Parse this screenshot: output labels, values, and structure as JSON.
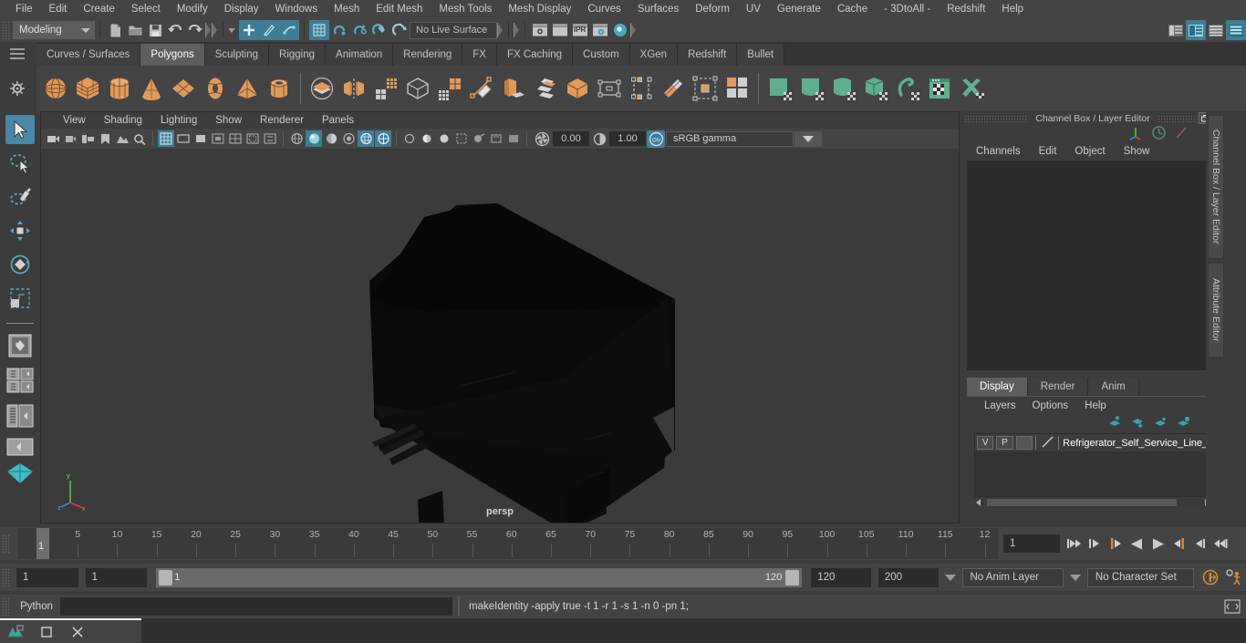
{
  "menubar": {
    "items": [
      "File",
      "Edit",
      "Create",
      "Select",
      "Modify",
      "Display",
      "Windows",
      "Mesh",
      "Edit Mesh",
      "Mesh Tools",
      "Mesh Display",
      "Curves",
      "Surfaces",
      "Deform",
      "UV",
      "Generate",
      "Cache",
      "- 3DtoAll -",
      "Redshift",
      "Help"
    ]
  },
  "statusline": {
    "menu_set": "Modeling",
    "live_surface": "No Live Surface",
    "ipr_label": "IPR",
    "icons": [
      "new-scene-icon",
      "open-scene-icon",
      "save-scene-icon",
      "undo-icon",
      "redo-icon",
      "select-by-hierarchy-icon",
      "select-by-object-icon",
      "select-by-component-icon",
      "snap-to-grid-icon",
      "snap-to-curve-icon",
      "snap-to-point-icon",
      "snap-to-projected-center-icon",
      "snap-to-view-plane-icon",
      "magnet-icon",
      "make-live-icon",
      "render-current-frame-icon",
      "ipr-render-icon",
      "render-settings-icon",
      "hypershade-icon",
      "show-channel-box-icon",
      "show-attribute-editor-icon",
      "show-tool-settings-icon"
    ]
  },
  "shelf": {
    "tabs": [
      "Curves / Surfaces",
      "Polygons",
      "Sculpting",
      "Rigging",
      "Animation",
      "Rendering",
      "FX",
      "FX Caching",
      "Custom",
      "XGen",
      "Redshift",
      "Bullet"
    ],
    "active_tab": "Polygons",
    "icons": [
      "poly-sphere-icon",
      "poly-cube-icon",
      "poly-cylinder-icon",
      "poly-cone-icon",
      "poly-plane-icon",
      "poly-torus-icon",
      "poly-pyramid-icon",
      "poly-pipe-icon",
      "poly-sphere-boolean-icon",
      "poly-combine-icon",
      "poly-mirror-icon",
      "poly-smooth-icon",
      "poly-extrude-icon",
      "poly-subdiv-icon",
      "poly-create-tool-icon",
      "poly-bevel-icon",
      "poly-bridge-icon",
      "poly-cube-duplicate-icon",
      "poly-quad-draw-icon",
      "poly-target-weld-icon",
      "poly-multi-cut-icon",
      "poly-separate-icon",
      "poly-merge-icon",
      "sculpt-grab-icon",
      "sculpt-smooth-icon",
      "sculpt-relax-icon",
      "sculpt-cube-icon",
      "sculpt-flow-icon",
      "sculpt-mask-icon",
      "sculpt-mirror-icon"
    ]
  },
  "toolbox": {
    "items": [
      "select-tool-icon",
      "lasso-select-tool-icon",
      "paint-select-tool-icon",
      "move-tool-icon",
      "rotate-tool-icon",
      "scale-tool-icon",
      "last-tool-icon",
      "four-view-layout-icon",
      "persp-outliner-layout-icon",
      "outliner-persp-layout-icon",
      "persp-graph-layout-icon",
      "hypershade-persp-layout-icon"
    ],
    "selected": "select-tool-icon"
  },
  "viewport": {
    "menu": [
      "View",
      "Shading",
      "Lighting",
      "Show",
      "Renderer",
      "Panels"
    ],
    "exposure_value": "0.00",
    "gamma_value": "1.00",
    "color_management": "sRGB gamma",
    "view_label": "persp",
    "axis_labels": [
      "x",
      "y",
      "z"
    ],
    "toolbar_icons": [
      "select-camera-icon",
      "lock-camera-icon",
      "camera-attributes-icon",
      "bookmarks-icon",
      "image-plane-icon",
      "two-d-pan-zoom-icon",
      "grid-icon",
      "film-gate-icon",
      "resolution-gate-icon",
      "gate-mask-icon",
      "field-chart-icon",
      "safe-action-icon",
      "safe-title-icon",
      "wireframe-icon",
      "smooth-shade-all-icon",
      "smooth-shade-selected-icon",
      "flat-shade-all-icon",
      "shaded-and-textured-icon",
      "use-default-material-icon",
      "wireframe-on-shaded-icon",
      "xray-icon",
      "xray-joints-icon",
      "xray-active-components-icon",
      "lighting-none-icon",
      "lighting-default-icon",
      "lighting-all-icon",
      "shadows-icon",
      "screen-space-ao-icon",
      "motion-blur-icon",
      "multisample-icon",
      "exposure-icon",
      "gamma-icon",
      "color-management-toggle-icon"
    ]
  },
  "channel_box": {
    "panel_title": "Channel Box / Layer Editor",
    "menu": [
      "Channels",
      "Edit",
      "Object",
      "Show"
    ],
    "header_icons": [
      "axis-orient-icon",
      "clock-icon",
      "pen-icon"
    ],
    "window_buttons": [
      "restore-window-icon",
      "close-window-icon"
    ],
    "side_tabs": [
      "Channel Box / Layer Editor",
      "Attribute Editor"
    ]
  },
  "layer_editor": {
    "tabs": [
      "Display",
      "Render",
      "Anim"
    ],
    "active_tab": "Display",
    "menu": [
      "Layers",
      "Options",
      "Help"
    ],
    "toolbar_icons": [
      "move-layer-up-icon",
      "move-layer-down-icon",
      "new-layer-icon",
      "new-layer-from-selected-icon"
    ],
    "layers": [
      {
        "visibility": "V",
        "playback": "P",
        "shading": "",
        "color_swatch": "template-line-icon",
        "name": "Refrigerator_Self_Service_Line_Elemen"
      }
    ]
  },
  "time_slider": {
    "tick_labels": [
      "5",
      "10",
      "15",
      "20",
      "25",
      "30",
      "35",
      "40",
      "45",
      "50",
      "55",
      "60",
      "65",
      "70",
      "75",
      "80",
      "85",
      "90",
      "95",
      "100",
      "105",
      "110",
      "115",
      "12"
    ],
    "current_frame_marker": "1",
    "current_frame_field": "1",
    "playback_icons": [
      "go-to-start-icon",
      "step-back-frame-icon",
      "step-back-key-icon",
      "play-backwards-icon",
      "play-forwards-icon",
      "step-forward-key-icon",
      "step-forward-frame-icon",
      "go-to-end-icon"
    ]
  },
  "range_slider": {
    "anim_start": "1",
    "range_start": "1",
    "range_bar_left_label": "1",
    "range_bar_right_label": "120",
    "range_end": "120",
    "anim_end": "200",
    "anim_layer": "No Anim Layer",
    "character_set": "No Character Set",
    "right_icons": [
      "auto-keyframe-icon",
      "animation-preferences-icon"
    ]
  },
  "command_line": {
    "language_label": "Python",
    "input_value": "",
    "result": "makeIdentity -apply true -t 1 -r 1 -s 1 -n 0 -pn 1;",
    "script_editor_icon": "script-editor-icon"
  },
  "taskbar": {
    "items": [
      "maya-app-icon",
      "window-restore-icon",
      "window-close-icon"
    ]
  },
  "colors": {
    "accent_teal": "#4a9bb5",
    "shelf_orange": "#e09a5a",
    "shelf_green": "#5fae8d",
    "panel_bg": "#3c3c3c",
    "bar_bg": "#444444",
    "field_bg": "#2b2b2b",
    "highlight": "#5e5e5e",
    "orange_marker": "#e08a2e"
  }
}
